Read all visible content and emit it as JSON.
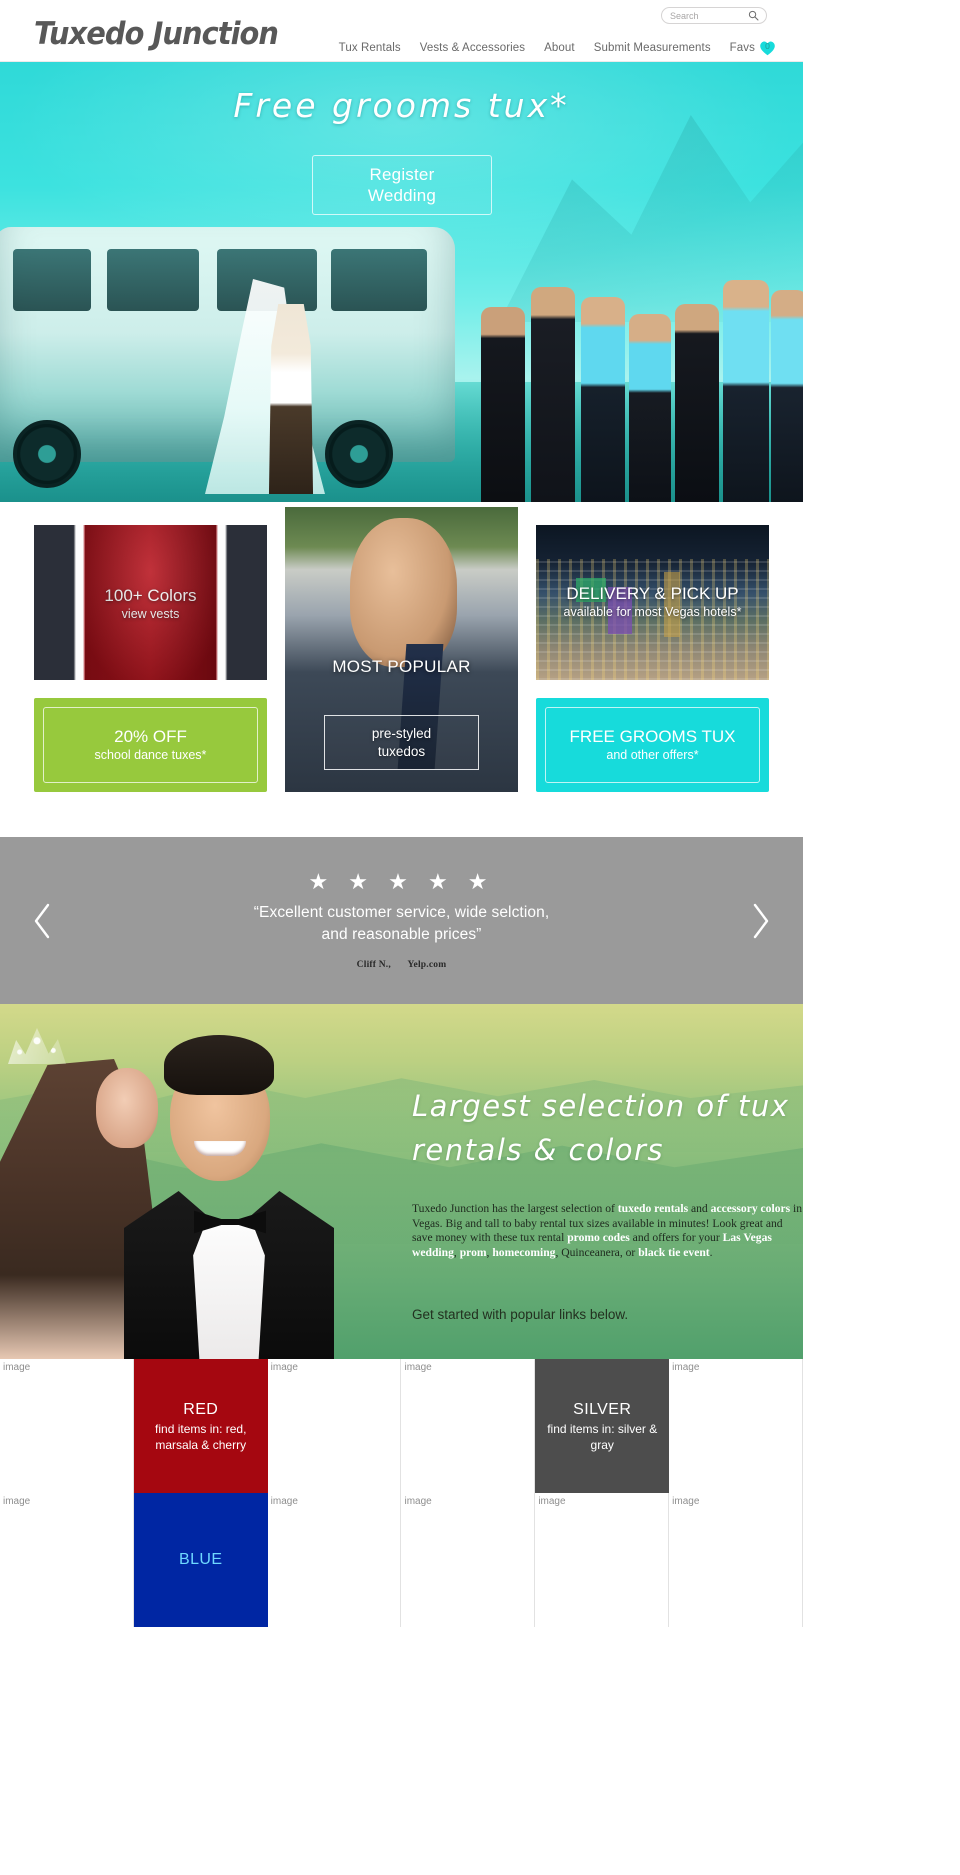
{
  "header": {
    "logo": "Tuxedo Junction",
    "search": {
      "placeholder": "Search",
      "value": ""
    },
    "nav": [
      {
        "label": "Tux Rentals"
      },
      {
        "label": "Vests & Accessories"
      },
      {
        "label": "About"
      },
      {
        "label": "Submit Measurements"
      }
    ],
    "favs": {
      "label": "Favs",
      "count": "0",
      "color": "#17dbdb"
    }
  },
  "hero": {
    "headline": "Free grooms tux*",
    "button_line1": "Register",
    "button_line2": "Wedding"
  },
  "promos": {
    "vest": {
      "big": "100+ Colors",
      "small": "view vests"
    },
    "couple": {
      "label": "MOST POPULAR",
      "btn_line1": "pre-styled",
      "btn_line2": "tuxedos"
    },
    "vegas": {
      "big": "DELIVERY & PICK UP",
      "small": "available for most Vegas hotels*"
    },
    "green_band": {
      "big": "20% OFF",
      "small": "school dance tuxes*",
      "color": "#97c93d"
    },
    "cyan_band": {
      "big": "FREE GROOMS TUX",
      "small": "and other offers*",
      "color": "#17dbdb"
    }
  },
  "testimonial": {
    "stars": "★ ★ ★ ★ ★",
    "quote_line1": "“Excellent customer service, wide selction,",
    "quote_line2": "and reasonable prices”",
    "author": "Cliff N.,",
    "source": "Yelp.com",
    "prev_icon": "chevron-left-icon",
    "next_icon": "chevron-right-icon"
  },
  "green_section": {
    "heading_line1": "Largest selection of tux",
    "heading_line2": "rentals & colors",
    "body_html": "Tuxedo Junction has the largest selection of <b class=\"lnk\">tuxedo rentals</b> and <b class=\"lnk\">accessory colors</b> in Vegas. Big and tall to baby rental tux sizes available in minutes! Look great and save money with these tux rental <b class=\"lnk\">promo codes</b> and offers for your <b class=\"lnk\">Las Vegas wedding</b>, <b class=\"lnk\">prom</b>, <b class=\"lnk\">homecoming</b>, Quinceanera, or <b class=\"lnk\">black tie event</b>.",
    "cta": "Get started with popular links below."
  },
  "color_grid": {
    "broken_image_alt": "image",
    "rows": [
      [
        {
          "type": "blank"
        },
        {
          "type": "swatch",
          "title": "RED",
          "sub": "find items in: red, marsala & cherry",
          "bg": "#a50710",
          "fg": "#ffffff"
        },
        {
          "type": "blank"
        },
        {
          "type": "blank"
        },
        {
          "type": "swatch",
          "title": "SILVER",
          "sub": "find items in: silver & gray",
          "bg": "#4d4d4d",
          "fg": "#ffffff"
        },
        {
          "type": "blank"
        }
      ],
      [
        {
          "type": "blank"
        },
        {
          "type": "swatch",
          "title": "BLUE",
          "sub": "",
          "bg": "#0026a3",
          "fg": "#6fd8ff"
        },
        {
          "type": "blank"
        },
        {
          "type": "blank"
        },
        {
          "type": "blank"
        },
        {
          "type": "blank"
        }
      ]
    ]
  }
}
